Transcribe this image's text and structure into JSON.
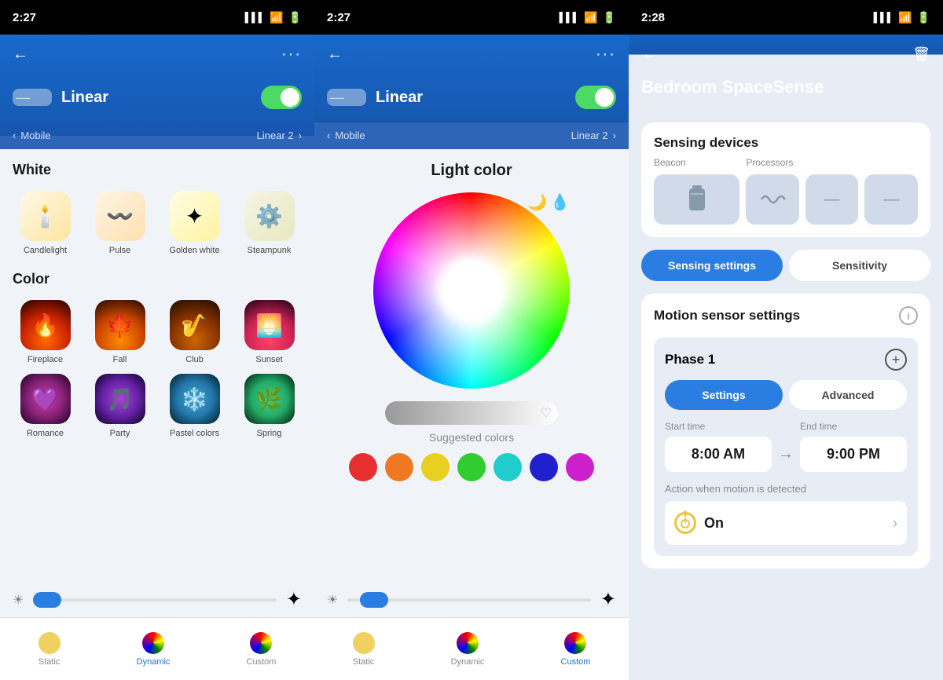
{
  "panel1": {
    "statusBar": {
      "time": "2:27",
      "icons": "signal wifi battery"
    },
    "nav": {
      "backLabel": "←",
      "dotsLabel": "···"
    },
    "device": {
      "name": "Linear",
      "toggleOn": true
    },
    "breadcrumb": {
      "left": "Mobile",
      "right": "Linear 2"
    },
    "sections": {
      "white": {
        "title": "White",
        "items": [
          {
            "label": "Candlelight",
            "icon": "🕯️"
          },
          {
            "label": "Pulse",
            "icon": "〰️"
          },
          {
            "label": "Golden white",
            "icon": "✳️"
          },
          {
            "label": "Steampunk",
            "icon": "🥽"
          }
        ]
      },
      "color": {
        "title": "Color",
        "items": [
          {
            "label": "Fireplace",
            "icon": "🔥"
          },
          {
            "label": "Fall",
            "icon": "🍁"
          },
          {
            "label": "Club",
            "icon": "🎷"
          },
          {
            "label": "Sunset",
            "icon": "🌅"
          },
          {
            "label": "Romance",
            "icon": "💜"
          },
          {
            "label": "Party",
            "icon": "🎵"
          },
          {
            "label": "Pastel colors",
            "icon": "❄️"
          },
          {
            "label": "Spring",
            "icon": "🌿"
          }
        ]
      }
    },
    "bottomTabs": [
      {
        "label": "Static",
        "active": false
      },
      {
        "label": "Dynamic",
        "active": true
      },
      {
        "label": "Custom",
        "active": false
      }
    ]
  },
  "panel2": {
    "statusBar": {
      "time": "2:27"
    },
    "device": {
      "name": "Linear",
      "toggleOn": true
    },
    "breadcrumb": {
      "left": "Mobile",
      "right": "Linear 2"
    },
    "colorSection": {
      "title": "Light color",
      "sliderHeart": "♡",
      "suggestedTitle": "Suggested colors",
      "colors": [
        "#e63030",
        "#f07820",
        "#e8d020",
        "#30cc30",
        "#20cccc",
        "#2020cc",
        "#cc20cc"
      ]
    },
    "bottomTabs": [
      {
        "label": "Static",
        "active": false
      },
      {
        "label": "Dynamic",
        "active": false
      },
      {
        "label": "Custom",
        "active": true
      }
    ]
  },
  "panel3": {
    "statusBar": {
      "time": "2:28"
    },
    "nav": {
      "backLabel": "←",
      "trashLabel": "🗑"
    },
    "title": "Bedroom SpaceSense",
    "sensing": {
      "title": "Sensing devices",
      "beaconLabel": "Beacon",
      "processorsLabel": "Processors",
      "beaconIcon": "🔋",
      "processorIcon1": "📡",
      "processorIcon2": "—",
      "processorIcon3": "—"
    },
    "tabs": [
      {
        "label": "Sensing settings",
        "active": true
      },
      {
        "label": "Sensitivity",
        "active": false
      }
    ],
    "motion": {
      "title": "Motion sensor settings",
      "phase": {
        "title": "Phase 1",
        "tabs": [
          {
            "label": "Settings",
            "active": true
          },
          {
            "label": "Advanced",
            "active": false
          }
        ],
        "startTimeLabel": "Start time",
        "startTime": "8:00 AM",
        "endTimeLabel": "End time",
        "endTime": "9:00 PM",
        "actionLabel": "Action when motion is detected",
        "actionText": "On"
      }
    }
  }
}
